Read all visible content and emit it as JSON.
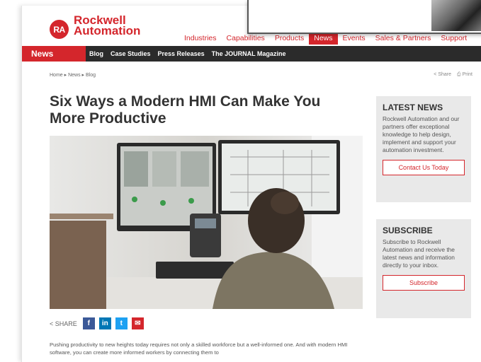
{
  "brand": {
    "badge": "RA",
    "line1": "Rockwell",
    "line2": "Automation"
  },
  "top_nav": [
    "Industries",
    "Capabilities",
    "Products",
    "News",
    "Events",
    "Sales & Partners",
    "Support"
  ],
  "top_nav_active": "News",
  "section": "News",
  "sub_nav": [
    "Blog",
    "Case Studies",
    "Press Releases",
    "The JOURNAL Magazine"
  ],
  "breadcrumb": "Home  ▸  News  ▸  Blog",
  "tools": {
    "share": "Share",
    "print": "Print"
  },
  "article": {
    "title": "Six Ways a Modern HMI Can Make You More Productive",
    "share_label": "SHARE",
    "body": "Pushing productivity to new heights today requires not only a skilled workforce but a well-informed one. And with modern HMI software, you can create more informed workers by connecting them to"
  },
  "sidebar": {
    "latest": {
      "heading": "LATEST NEWS",
      "text": "Rockwell Automation and our partners offer exceptional knowledge to help design, implement and support your automation investment.",
      "button": "Contact Us Today"
    },
    "subscribe": {
      "heading": "SUBSCRIBE",
      "text": "Subscribe to Rockwell Automation and receive the latest news and information directly to your inbox.",
      "button": "Subscribe"
    }
  },
  "colors": {
    "brand_red": "#d4262c",
    "subnav_bg": "#2b2b2b",
    "sidebar_bg": "#e9e9e9"
  },
  "icons": [
    "share-icon",
    "print-icon",
    "facebook-icon",
    "linkedin-icon",
    "twitter-icon",
    "email-icon"
  ]
}
